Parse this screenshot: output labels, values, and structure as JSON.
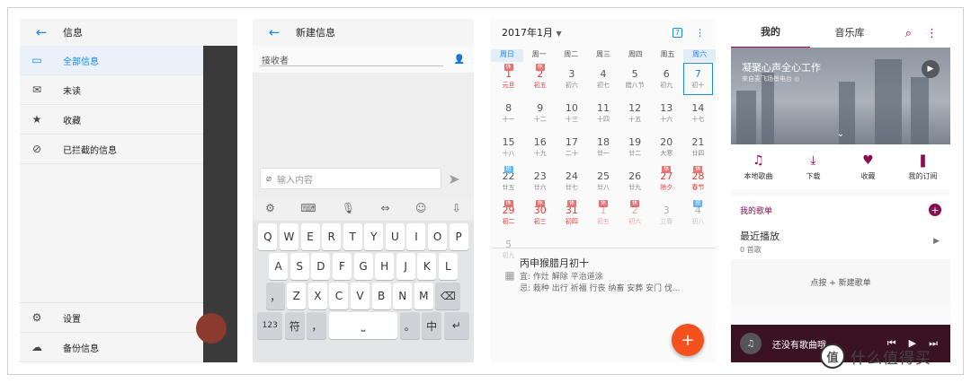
{
  "messages_drawer": {
    "title": "信息",
    "items": [
      {
        "label": "全部信息",
        "active": true
      },
      {
        "label": "未读"
      },
      {
        "label": "收藏"
      },
      {
        "label": "已拦截的信息"
      }
    ],
    "bottom_items": [
      {
        "label": "设置"
      },
      {
        "label": "备份信息"
      }
    ]
  },
  "new_message": {
    "title": "新建信息",
    "recipient_placeholder": "接收者",
    "input_placeholder": "输入内容",
    "keyboard": {
      "row1": [
        "Q",
        "W",
        "E",
        "R",
        "T",
        "Y",
        "U",
        "I",
        "O",
        "P"
      ],
      "row2": [
        "A",
        "S",
        "D",
        "F",
        "G",
        "H",
        "J",
        "K",
        "L"
      ],
      "row3": [
        "，",
        "Z",
        "X",
        "C",
        "V",
        "B",
        "N",
        "M"
      ],
      "row4": {
        "num": "123",
        "sym": "符",
        "comma": "，",
        "zh": "中",
        "period": "。"
      }
    }
  },
  "calendar": {
    "month": "2017年1月",
    "today_badge": "7",
    "weekdays": [
      "周日",
      "周一",
      "周二",
      "周三",
      "周四",
      "周五",
      "周六"
    ],
    "weeks": [
      [
        {
          "d": "1",
          "l": "元旦",
          "red": true,
          "badge": "休",
          "bt": "rest"
        },
        {
          "d": "2",
          "l": "初五",
          "red": true,
          "badge": "休",
          "bt": "rest"
        },
        {
          "d": "3",
          "l": "初六"
        },
        {
          "d": "4",
          "l": "初七"
        },
        {
          "d": "5",
          "l": "腊八节"
        },
        {
          "d": "6",
          "l": "初九"
        },
        {
          "d": "7",
          "l": "初十",
          "today": true
        }
      ],
      [
        {
          "d": "8",
          "l": "十一"
        },
        {
          "d": "9",
          "l": "十二"
        },
        {
          "d": "10",
          "l": "十三"
        },
        {
          "d": "11",
          "l": "十四"
        },
        {
          "d": "12",
          "l": "十五"
        },
        {
          "d": "13",
          "l": "十六"
        },
        {
          "d": "14",
          "l": "十七"
        }
      ],
      [
        {
          "d": "15",
          "l": "十八"
        },
        {
          "d": "16",
          "l": "十九"
        },
        {
          "d": "17",
          "l": "二十"
        },
        {
          "d": "18",
          "l": "廿一"
        },
        {
          "d": "19",
          "l": "廿二"
        },
        {
          "d": "20",
          "l": "大寒"
        },
        {
          "d": "21",
          "l": "廿四"
        }
      ],
      [
        {
          "d": "22",
          "l": "廿五",
          "badge": "班",
          "bt": "work"
        },
        {
          "d": "23",
          "l": "廿六"
        },
        {
          "d": "24",
          "l": "廿七"
        },
        {
          "d": "25",
          "l": "廿八"
        },
        {
          "d": "26",
          "l": "廿九"
        },
        {
          "d": "27",
          "l": "除夕",
          "red": true,
          "badge": "休",
          "bt": "rest"
        },
        {
          "d": "28",
          "l": "春节",
          "red": true,
          "badge": "休",
          "bt": "rest"
        }
      ],
      [
        {
          "d": "29",
          "l": "初二",
          "red": true,
          "badge": "休",
          "bt": "rest"
        },
        {
          "d": "30",
          "l": "初三",
          "red": true,
          "badge": "休",
          "bt": "rest"
        },
        {
          "d": "31",
          "l": "初四",
          "red": true,
          "badge": "休",
          "bt": "rest"
        },
        {
          "d": "1",
          "l": "初五",
          "red": true,
          "faded": true,
          "badge": "休",
          "bt": "rest"
        },
        {
          "d": "2",
          "l": "初六",
          "red": true,
          "faded": true,
          "badge": "休",
          "bt": "rest"
        },
        {
          "d": "3",
          "l": "立春",
          "faded": true
        },
        {
          "d": "4",
          "l": "初八",
          "faded": true,
          "badge": "班",
          "bt": "work"
        }
      ],
      [
        {
          "d": "5",
          "l": "初九",
          "faded": true
        }
      ]
    ],
    "lunar_title": "丙申猴腊月初十",
    "yi": "宜: 作灶 解除 平治道涂",
    "ji": "忌: 栽种 出行 祈福 行丧 纳畜 安葬 安门 伐..."
  },
  "music": {
    "tabs": [
      "我的",
      "音乐库"
    ],
    "hero_title": "凝聚心声全心工作",
    "hero_subtitle": "来自麦飞场景电台 ◎",
    "shortcuts": [
      {
        "label": "本地歌曲",
        "icon": "♫"
      },
      {
        "label": "下载",
        "icon": "⤓"
      },
      {
        "label": "收藏",
        "icon": "♥"
      },
      {
        "label": "我的订阅",
        "icon": "❚"
      }
    ],
    "my_playlists": "我的歌单",
    "recent_title": "最近播放",
    "recent_count": "0 首歌",
    "create_hint": "点按 + 新建歌单",
    "player_text": "还没有歌曲哦"
  },
  "watermark": {
    "logo": "值",
    "text": "什么值得买"
  },
  "colors": {
    "accent_blue": "#1e88e5",
    "music_accent": "#880e4f",
    "fab_orange": "#f4511e",
    "holiday_red": "#e53935"
  }
}
